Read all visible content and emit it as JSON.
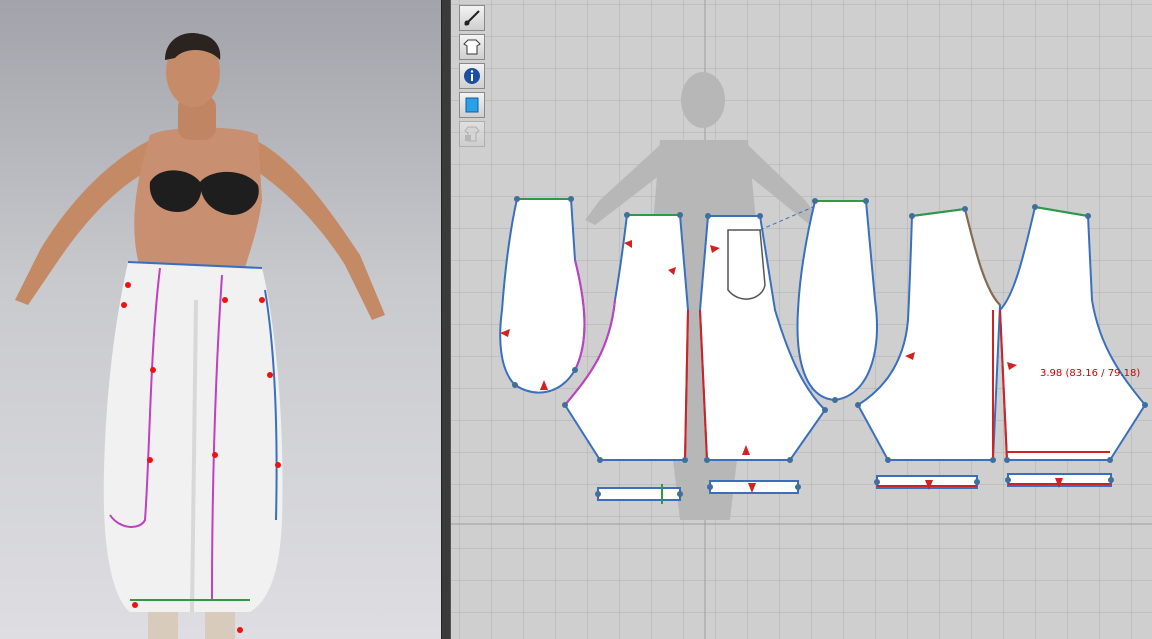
{
  "views": {
    "left": "3D Avatar View",
    "right": "2D Pattern View"
  },
  "toolbar": {
    "tools": [
      {
        "name": "show-avatar-pen-icon"
      },
      {
        "name": "show-garment-icon"
      },
      {
        "name": "info-icon"
      },
      {
        "name": "texture-icon"
      },
      {
        "name": "lock-garment-icon",
        "disabled": true
      }
    ]
  },
  "measurement": {
    "text": "3.98 (83.16 / 79.18)"
  },
  "colors": {
    "pattern_fill": "#ffffff",
    "outline_blue": "#3a6fbf",
    "seam_red": "#d32020",
    "seam_green": "#2e9a44",
    "seam_magenta": "#c040c0",
    "point": "#3f6f9a"
  }
}
